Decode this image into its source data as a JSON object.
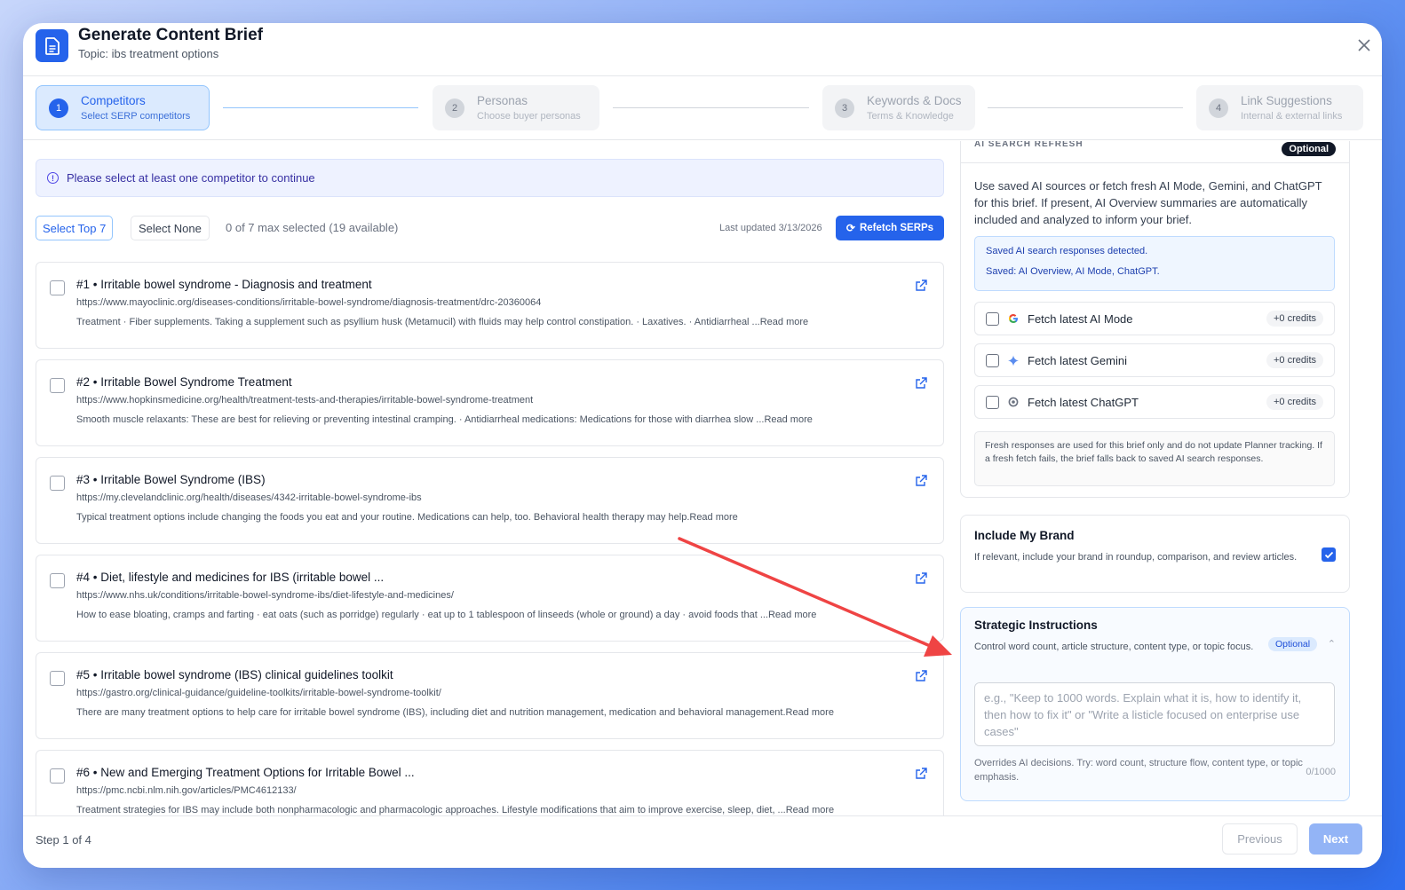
{
  "header": {
    "title": "Generate Content Brief",
    "subtitle": "Topic: ibs treatment options",
    "close_icon": "close-icon"
  },
  "stepper": [
    {
      "num": "1",
      "title": "Competitors",
      "sub": "Select SERP competitors",
      "active": true
    },
    {
      "num": "2",
      "title": "Personas",
      "sub": "Choose buyer personas",
      "active": false
    },
    {
      "num": "3",
      "title": "Keywords & Docs",
      "sub": "Terms & Knowledge",
      "active": false
    },
    {
      "num": "4",
      "title": "Link Suggestions",
      "sub": "Internal & external links",
      "active": false
    }
  ],
  "alert": {
    "text": "Please select at least one competitor to continue"
  },
  "toolbar": {
    "select_top": "Select Top 7",
    "select_none": "Select None",
    "count": "0 of 7 max selected (19 available)",
    "last_updated": "Last updated 3/13/2026",
    "refetch": "Refetch SERPs"
  },
  "competitors": [
    {
      "title": "#1 • Irritable bowel syndrome - Diagnosis and treatment",
      "url": "https://www.mayoclinic.org/diseases-conditions/irritable-bowel-syndrome/diagnosis-treatment/drc-20360064",
      "desc": "Treatment · Fiber supplements. Taking a supplement such as psyllium husk (Metamucil) with fluids may help control constipation. · Laxatives. · Antidiarrheal ...Read more"
    },
    {
      "title": "#2 • Irritable Bowel Syndrome Treatment",
      "url": "https://www.hopkinsmedicine.org/health/treatment-tests-and-therapies/irritable-bowel-syndrome-treatment",
      "desc": "Smooth muscle relaxants: These are best for relieving or preventing intestinal cramping. · Antidiarrheal medications: Medications for those with diarrhea slow ...Read more"
    },
    {
      "title": "#3 • Irritable Bowel Syndrome (IBS)",
      "url": "https://my.clevelandclinic.org/health/diseases/4342-irritable-bowel-syndrome-ibs",
      "desc": "Typical treatment options include changing the foods you eat and your routine. Medications can help, too. Behavioral health therapy may help.Read more"
    },
    {
      "title": "#4 • Diet, lifestyle and medicines for IBS (irritable bowel ...",
      "url": "https://www.nhs.uk/conditions/irritable-bowel-syndrome-ibs/diet-lifestyle-and-medicines/",
      "desc": "How to ease bloating, cramps and farting · eat oats (such as porridge) regularly · eat up to 1 tablespoon of linseeds (whole or ground) a day · avoid foods that ...Read more"
    },
    {
      "title": "#5 • Irritable bowel syndrome (IBS) clinical guidelines toolkit",
      "url": "https://gastro.org/clinical-guidance/guideline-toolkits/irritable-bowel-syndrome-toolkit/",
      "desc": "There are many treatment options to help care for irritable bowel syndrome (IBS), including diet and nutrition management, medication and behavioral management.Read more"
    },
    {
      "title": "#6 • New and Emerging Treatment Options for Irritable Bowel ...",
      "url": "https://pmc.ncbi.nlm.nih.gov/articles/PMC4612133/",
      "desc": "Treatment strategies for IBS may include both nonpharmacologic and pharmacologic approaches. Lifestyle modifications that aim to improve exercise, sleep, diet, ...Read more"
    }
  ],
  "ai_search": {
    "header": "AI SEARCH REFRESH",
    "badge": "Optional",
    "desc": "Use saved AI sources or fetch fresh AI Mode, Gemini, and ChatGPT for this brief. If present, AI Overview summaries are automatically included and analyzed to inform your brief.",
    "saved_title": "Saved AI search responses detected.",
    "saved_list": "Saved: AI Overview, AI Mode, ChatGPT.",
    "fetch": [
      {
        "label": "Fetch latest AI Mode",
        "credits": "+0 credits",
        "icon": "google-icon"
      },
      {
        "label": "Fetch latest Gemini",
        "credits": "+0 credits",
        "icon": "gemini-icon"
      },
      {
        "label": "Fetch latest ChatGPT",
        "credits": "+0 credits",
        "icon": "chatgpt-icon"
      }
    ],
    "note": "Fresh responses are used for this brief only and do not update Planner tracking. If a fresh fetch fails, the brief falls back to saved AI search responses."
  },
  "brand": {
    "title": "Include My Brand",
    "desc": "If relevant, include your brand in roundup, comparison, and review articles.",
    "checked": true
  },
  "strategic": {
    "title": "Strategic Instructions",
    "desc": "Control word count, article structure, content type, or topic focus.",
    "badge": "Optional",
    "placeholder": "e.g., \"Keep to 1000 words. Explain what it is, how to identify it, then how to fix it\" or \"Write a listicle focused on enterprise use cases\"",
    "help": "Overrides AI decisions. Try: word count, structure flow, content type, or topic emphasis.",
    "count": "0/1000"
  },
  "footer": {
    "step": "Step 1 of 4",
    "previous": "Previous",
    "next": "Next"
  },
  "colors": {
    "accent": "#2563eb",
    "annotation_arrow": "#ef4444"
  }
}
